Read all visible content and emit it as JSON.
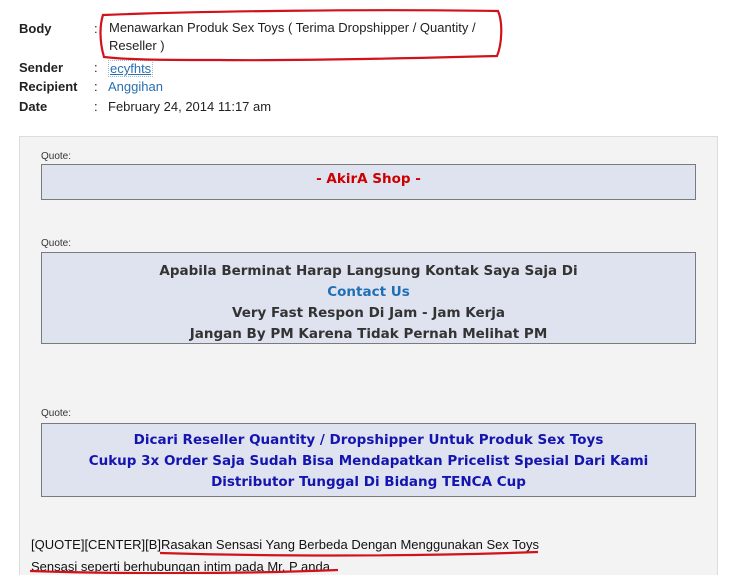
{
  "meta": {
    "body_label": "Body",
    "body_value": "Menawarkan Produk Sex Toys ( Terima Dropshipper / Quantity / Reseller )",
    "sender_label": "Sender",
    "sender_value": "ecyfhts",
    "recipient_label": "Recipient",
    "recipient_value": "Anggihan",
    "date_label": "Date",
    "date_value": "February 24, 2014 11:17 am",
    "colon": ":"
  },
  "quotes": [
    {
      "label": "Quote:",
      "lines": [
        "- AkirA Shop -"
      ]
    },
    {
      "label": "Quote:",
      "lines": [
        "Apabila Berminat Harap Langsung Kontak Saya Saja Di",
        "Contact Us",
        "Very Fast Respon Di Jam - Jam Kerja",
        "Jangan By PM Karena Tidak Pernah Melihat PM"
      ]
    },
    {
      "label": "Quote:",
      "lines": [
        "Dicari Reseller Quantity / Dropshipper Untuk Produk Sex Toys",
        "Cukup 3x Order Saja Sudah Bisa Mendapatkan Pricelist Spesial Dari Kami",
        "Distributor Tunggal Di Bidang TENCA Cup"
      ]
    }
  ],
  "raw": {
    "line1": "[QUOTE][CENTER][B]Rasakan Sensasi Yang Berbeda Dengan Menggunakan Sex Toys",
    "line2": "Sensasi seperti berhubungan intim pada Mr. P anda"
  },
  "colors": {
    "annotation": "#d0121b",
    "quote_bg": "#dfe3ef",
    "link": "#2a6fb0"
  }
}
